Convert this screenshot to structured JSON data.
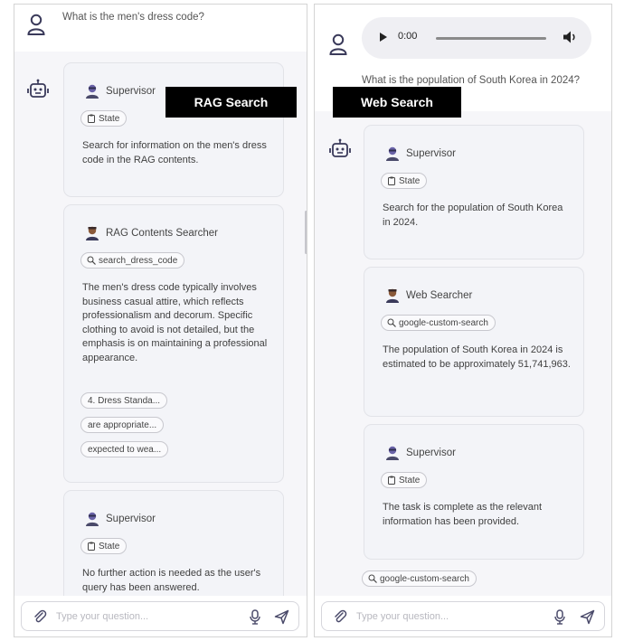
{
  "left": {
    "user_message": "What is the men's dress code?",
    "label": "RAG Search",
    "cards": [
      {
        "agent": "Supervisor",
        "chip": "State",
        "text": "Search for information on the men's dress code in the RAG contents."
      },
      {
        "agent": "RAG Contents Searcher",
        "chip": "search_dress_code",
        "text": "The men's dress code typically involves business casual attire, which reflects professionalism and decorum. Specific clothing to avoid is not detailed, but the emphasis is on maintaining a professional appearance.",
        "references": [
          "4. Dress Standa...",
          "are appropriate...",
          "expected to wea..."
        ]
      },
      {
        "agent": "Supervisor",
        "chip": "State",
        "text": "No further action is needed as the user's query has been answered."
      }
    ],
    "input_placeholder": "Type your question..."
  },
  "right": {
    "audio_time": "0:00",
    "user_message": "What is the population of South Korea in 2024?",
    "label": "Web Search",
    "cards": [
      {
        "agent": "Supervisor",
        "chip": "State",
        "text": "Search for the population of South Korea in 2024."
      },
      {
        "agent": "Web Searcher",
        "chip": "google-custom-search",
        "text": "The population of South Korea in 2024 is estimated to be approximately 51,741,963."
      },
      {
        "agent": "Supervisor",
        "chip": "State",
        "text": "The task is complete as the relevant information has been provided."
      }
    ],
    "tool_chip": "google-custom-search",
    "input_placeholder": "Type your question..."
  },
  "icons": {
    "user": "user-outline-icon",
    "bot": "robot-icon",
    "agent": "agent-avatar-icon",
    "state": "clipboard-icon",
    "tool": "search-tool-icon",
    "attach": "paperclip-icon",
    "mic": "microphone-icon",
    "send": "send-icon",
    "play": "play-icon",
    "volume": "volume-icon"
  },
  "colors": {
    "accent_icon": "#4a4a6a",
    "card_bg": "#f3f4f8",
    "label_bg": "#000000"
  }
}
